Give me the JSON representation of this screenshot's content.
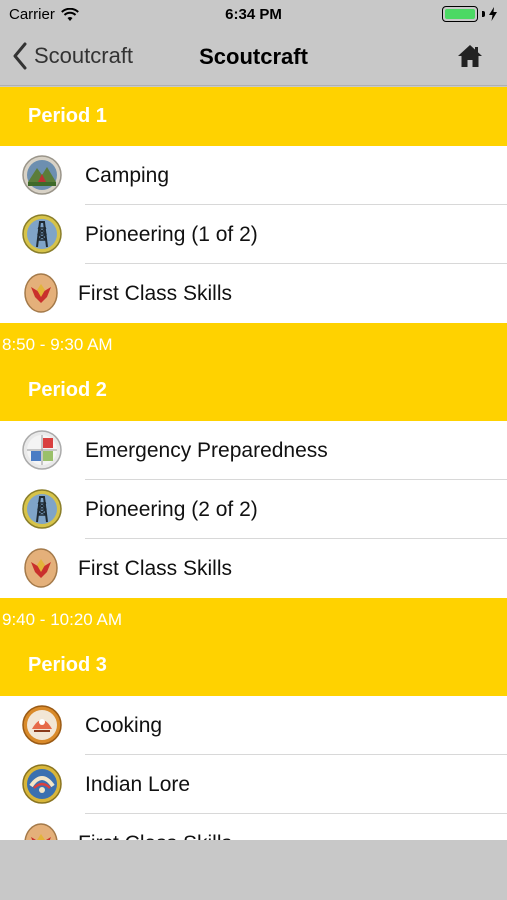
{
  "status": {
    "carrier": "Carrier",
    "time": "6:34 PM",
    "battery_level": 1.0,
    "battery_color": "#4cd964"
  },
  "nav": {
    "back_label": "Scoutcraft",
    "title": "Scoutcraft",
    "home_icon": "home-icon"
  },
  "colors": {
    "accent": "#ffd200",
    "bar": "#c8c8c8"
  },
  "periods": [
    {
      "label": "Period 1",
      "items": [
        {
          "label": "Camping",
          "icon": "camping-badge-icon"
        },
        {
          "label": "Pioneering (1 of 2)",
          "icon": "pioneering-badge-icon"
        },
        {
          "label": "First Class Skills",
          "icon": "first-class-badge-icon"
        }
      ]
    },
    {
      "time": "8:50 - 9:30 AM",
      "label": "Period 2",
      "items": [
        {
          "label": "Emergency Preparedness",
          "icon": "emergency-prep-badge-icon"
        },
        {
          "label": "Pioneering (2 of 2)",
          "icon": "pioneering-badge-icon"
        },
        {
          "label": "First Class Skills",
          "icon": "first-class-badge-icon"
        }
      ]
    },
    {
      "time": "9:40 - 10:20 AM",
      "label": "Period 3",
      "items": [
        {
          "label": "Cooking",
          "icon": "cooking-badge-icon"
        },
        {
          "label": "Indian Lore",
          "icon": "indian-lore-badge-icon"
        },
        {
          "label": "First Class Skills",
          "icon": "first-class-badge-icon"
        }
      ]
    }
  ]
}
